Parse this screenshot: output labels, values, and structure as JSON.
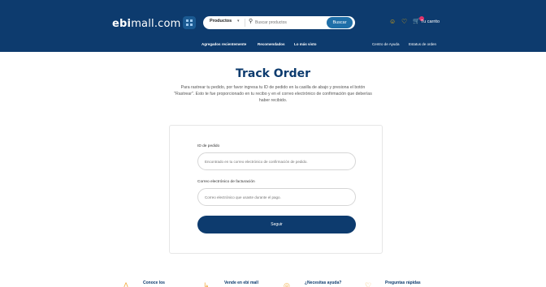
{
  "header": {
    "logo_bold": "ebi",
    "logo_rest": "mall.com",
    "search": {
      "category": "Productos",
      "chevron": "▾",
      "placeholder": "Buscar productos",
      "button": "Buscar"
    },
    "icons": {
      "user": "☺",
      "heart": "♡",
      "cart": "🛒"
    },
    "cart_label": "Tu carrito",
    "nav_left": [
      "Agregados recientemente",
      "Recomendados",
      "Lo más visto"
    ],
    "nav_right": [
      "Centro de Ayuda",
      "Estatus de orden"
    ]
  },
  "main": {
    "title": "Track Order",
    "description": "Para rastrear tu pedido, por favor ingresa tu ID de pedido en la casilla de abajo y presiona el botón \"Rastrear\". Esto te fue proporcionado en tu recibo y en el correo electrónico de confirmación que deberías haber recibido.",
    "order_id_label": "ID de pedido",
    "order_id_placeholder": "Encontrado en tu correo electrónico de confirmación de pedido.",
    "email_label": "Correo electrónico de facturación",
    "email_placeholder": "Correo electrónico que usaste durante el pago.",
    "submit_label": "Seguir"
  },
  "footer": {
    "features": [
      "Conoce los",
      "Vende en ebi mall",
      "¿Necesitas ayuda?",
      "Preguntas rápidas"
    ],
    "feature_icons": [
      "Δ",
      "↳",
      "◎",
      "♡"
    ]
  },
  "colors": {
    "brand": "#0d3b6e",
    "accent": "#f5b301",
    "button": "#1f6fa8"
  }
}
